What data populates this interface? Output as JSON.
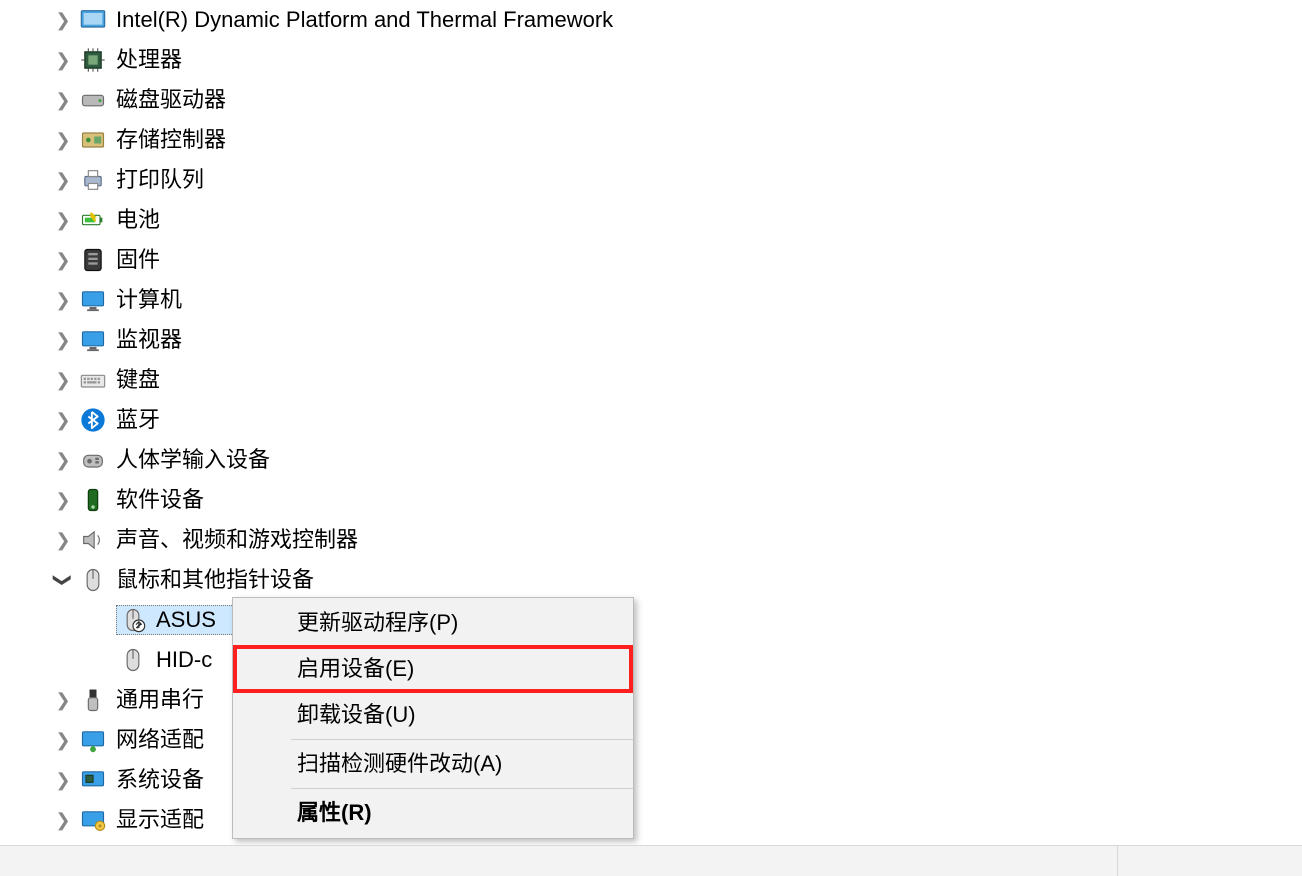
{
  "tree": {
    "nodes": [
      {
        "id": "intel-dptf",
        "label": "Intel(R) Dynamic Platform and Thermal Framework",
        "icon": "thermal",
        "expanded": false
      },
      {
        "id": "processors",
        "label": "处理器",
        "icon": "cpu",
        "expanded": false
      },
      {
        "id": "disk-drives",
        "label": "磁盘驱动器",
        "icon": "disk",
        "expanded": false
      },
      {
        "id": "storage-ctrl",
        "label": "存储控制器",
        "icon": "storage",
        "expanded": false
      },
      {
        "id": "print-queues",
        "label": "打印队列",
        "icon": "printer",
        "expanded": false
      },
      {
        "id": "batteries",
        "label": "电池",
        "icon": "battery",
        "expanded": false
      },
      {
        "id": "firmware",
        "label": "固件",
        "icon": "firmware",
        "expanded": false
      },
      {
        "id": "computer",
        "label": "计算机",
        "icon": "monitor",
        "expanded": false
      },
      {
        "id": "monitors",
        "label": "监视器",
        "icon": "monitor",
        "expanded": false
      },
      {
        "id": "keyboards",
        "label": "键盘",
        "icon": "keyboard",
        "expanded": false
      },
      {
        "id": "bluetooth",
        "label": "蓝牙",
        "icon": "bluetooth",
        "expanded": false
      },
      {
        "id": "hid",
        "label": "人体学输入设备",
        "icon": "hid",
        "expanded": false
      },
      {
        "id": "soft-devices",
        "label": "软件设备",
        "icon": "softdev",
        "expanded": false
      },
      {
        "id": "sound-video",
        "label": "声音、视频和游戏控制器",
        "icon": "speaker",
        "expanded": false
      },
      {
        "id": "mice",
        "label": "鼠标和其他指针设备",
        "icon": "mouse",
        "expanded": true,
        "children": [
          {
            "id": "asus-device",
            "label": "ASUS",
            "icon": "mouse-disabled",
            "selected": true,
            "truncated": true
          },
          {
            "id": "hid-mouse",
            "label": "HID-c",
            "icon": "mouse",
            "truncated": true
          }
        ]
      },
      {
        "id": "usb-ctrl",
        "label": "通用串行",
        "icon": "usb",
        "expanded": false,
        "truncated": true
      },
      {
        "id": "network",
        "label": "网络适配",
        "icon": "network",
        "expanded": false,
        "truncated": true
      },
      {
        "id": "system",
        "label": "系统设备",
        "icon": "system",
        "expanded": false
      },
      {
        "id": "display",
        "label": "显示适配",
        "icon": "display",
        "expanded": false,
        "truncated": true
      }
    ]
  },
  "context_menu": {
    "items": [
      {
        "id": "update-driver",
        "label": "更新驱动程序(P)"
      },
      {
        "id": "enable-device",
        "label": "启用设备(E)",
        "highlight": true
      },
      {
        "id": "uninstall",
        "label": "卸载设备(U)"
      },
      {
        "sep": true
      },
      {
        "id": "scan-hw",
        "label": "扫描检测硬件改动(A)"
      },
      {
        "sep": true
      },
      {
        "id": "properties",
        "label": "属性(R)",
        "bold": true
      }
    ]
  }
}
